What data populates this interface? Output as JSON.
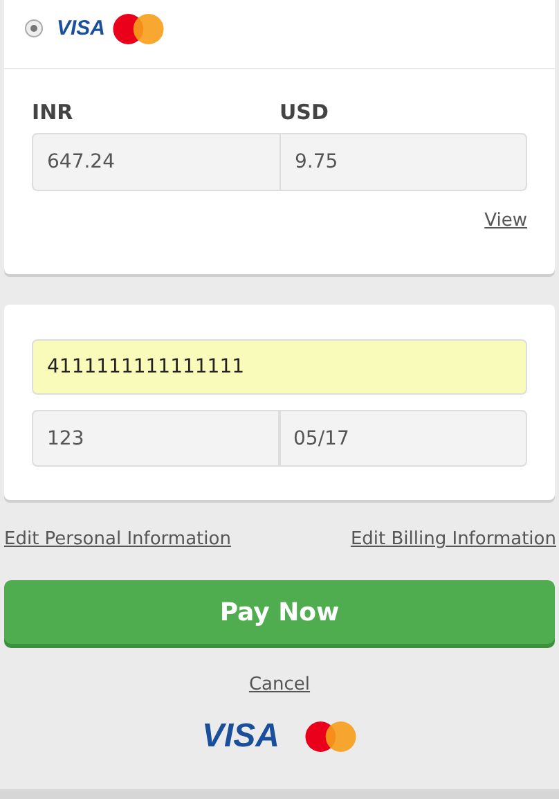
{
  "payment_method": {
    "selected": true,
    "brand_text": "VISA"
  },
  "amounts": {
    "columns": [
      {
        "label": "INR",
        "value": "647.24"
      },
      {
        "label": "USD",
        "value": "9.75"
      }
    ],
    "view_link": "View"
  },
  "card_form": {
    "card_number": "4111111111111111",
    "cvv": "123",
    "expiry": "05/17"
  },
  "links": [
    "Edit Personal Information",
    "Edit Billing Information"
  ],
  "pay_button": "Pay Now",
  "cancel_link": "Cancel",
  "footer_logos": {
    "brand_text": "VISA"
  }
}
